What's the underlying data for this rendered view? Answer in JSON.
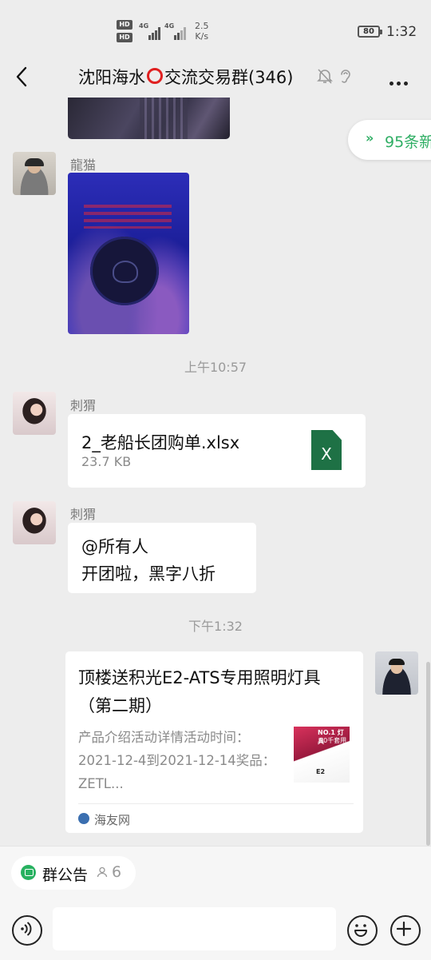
{
  "status_bar": {
    "network_badge_top": "HD",
    "network_badge_bottom": "HD",
    "sim1_type": "4G",
    "sim2_type": "4G",
    "speed_value": "2.5",
    "speed_unit": "K/s",
    "battery": "80",
    "time": "1:32"
  },
  "header": {
    "title_before": "沈阳海水",
    "title_after": "交流交易群(346)",
    "bell_icon": "muted-bell-icon",
    "ear_icon": "ear-icon",
    "more_icon": "more-icon"
  },
  "new_messages": {
    "label": "95条新"
  },
  "messages": [
    {
      "type": "image",
      "sender": "龍猫"
    },
    {
      "type": "timestamp",
      "text": "上午10:57"
    },
    {
      "type": "file",
      "sender": "刺猬",
      "file_name": "2_老船长团购单.xlsx",
      "file_size": "23.7 KB",
      "file_icon_letter": "X"
    },
    {
      "type": "text",
      "sender": "刺猬",
      "line1": "@所有人",
      "line2": "开团啦，黑字八折"
    },
    {
      "type": "timestamp",
      "text": "下午1:32"
    },
    {
      "type": "link",
      "title": "顶楼送积光E2-ATS专用照明灯具（第二期）",
      "description": "产品介绍活动详情活动时间：2021-12-4到2021-12-14奖品：ZETL...",
      "source": "海友网",
      "thumb_text_1": "NO.1 灯具",
      "thumb_text_2": "50千套用",
      "thumb_text_3": "E2"
    }
  ],
  "bottom_bar": {
    "notice_label": "群公告",
    "notice_count": "6",
    "input_value": "",
    "voice_icon": "voice-icon",
    "emoji_icon": "emoji-icon",
    "plus_icon": "plus-icon"
  }
}
